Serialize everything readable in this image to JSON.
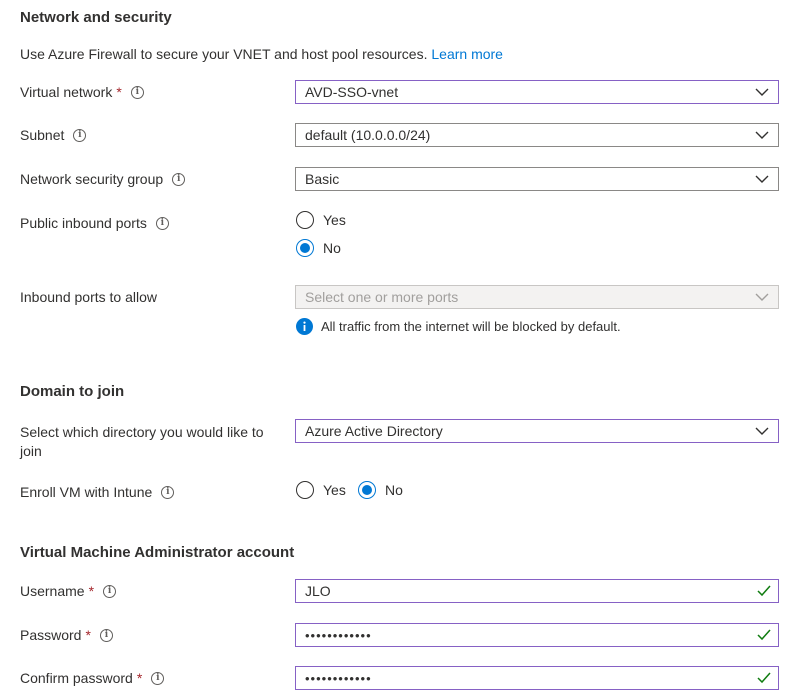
{
  "network": {
    "title": "Network and security",
    "description": "Use Azure Firewall to secure your VNET and host pool resources.",
    "learn_more": "Learn more",
    "virtual_network": {
      "label": "Virtual network",
      "required": "*",
      "value": "AVD-SSO-vnet"
    },
    "subnet": {
      "label": "Subnet",
      "value": "default (10.0.0.0/24)"
    },
    "nsg": {
      "label": "Network security group",
      "value": "Basic"
    },
    "public_inbound": {
      "label": "Public inbound ports",
      "yes": "Yes",
      "no": "No",
      "selected": "No"
    },
    "inbound_allow": {
      "label": "Inbound ports to allow",
      "placeholder": "Select one or more ports"
    },
    "info_message": "All traffic from the internet will be blocked by default."
  },
  "domain": {
    "title": "Domain to join",
    "directory": {
      "label_line1": "Select which directory you would like to",
      "label_line2": "join",
      "value": "Azure Active Directory"
    },
    "intune": {
      "label": "Enroll VM with Intune",
      "yes": "Yes",
      "no": "No",
      "selected": "No"
    }
  },
  "admin": {
    "title": "Virtual Machine Administrator account",
    "username": {
      "label": "Username",
      "required": "*",
      "value": "JLO"
    },
    "password": {
      "label": "Password",
      "required": "*",
      "value": "••••••••••••"
    },
    "confirm": {
      "label": "Confirm password",
      "required": "*",
      "value": "••••••••••••"
    }
  },
  "icons": {
    "info": "i",
    "accent": "#0078d4",
    "focus_border": "#8661c5",
    "valid_check": "#107c10"
  }
}
